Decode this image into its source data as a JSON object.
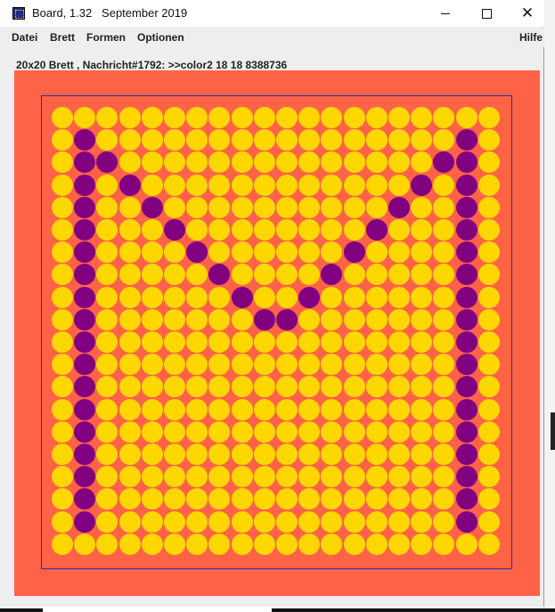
{
  "window": {
    "title": "Board, 1.32   September 2019",
    "minimize_icon": "minimize-icon",
    "maximize_icon": "maximize-icon",
    "close_icon": "close-icon",
    "close_glyph": "✕"
  },
  "menu": {
    "items": [
      "Datei",
      "Brett",
      "Formen",
      "Optionen"
    ],
    "help": "Hilfe"
  },
  "status": {
    "text": "20x20 Brett , Nachricht#1792: >>color2 18 18 8388736"
  },
  "board": {
    "rows": 20,
    "cols": 20,
    "background_color": "#ff6347",
    "border_color": "#2a2ab0",
    "default_color": "#ffd700",
    "marked_color": "#800080",
    "marked_cells": [
      [
        1,
        1
      ],
      [
        2,
        1
      ],
      [
        3,
        1
      ],
      [
        4,
        1
      ],
      [
        5,
        1
      ],
      [
        6,
        1
      ],
      [
        7,
        1
      ],
      [
        8,
        1
      ],
      [
        9,
        1
      ],
      [
        10,
        1
      ],
      [
        11,
        1
      ],
      [
        12,
        1
      ],
      [
        13,
        1
      ],
      [
        14,
        1
      ],
      [
        15,
        1
      ],
      [
        16,
        1
      ],
      [
        17,
        1
      ],
      [
        18,
        1
      ],
      [
        1,
        18
      ],
      [
        2,
        18
      ],
      [
        3,
        18
      ],
      [
        4,
        18
      ],
      [
        5,
        18
      ],
      [
        6,
        18
      ],
      [
        7,
        18
      ],
      [
        8,
        18
      ],
      [
        9,
        18
      ],
      [
        10,
        18
      ],
      [
        11,
        18
      ],
      [
        12,
        18
      ],
      [
        13,
        18
      ],
      [
        14,
        18
      ],
      [
        15,
        18
      ],
      [
        16,
        18
      ],
      [
        17,
        18
      ],
      [
        18,
        18
      ],
      [
        2,
        2
      ],
      [
        3,
        3
      ],
      [
        4,
        4
      ],
      [
        5,
        5
      ],
      [
        6,
        6
      ],
      [
        7,
        7
      ],
      [
        8,
        8
      ],
      [
        9,
        9
      ],
      [
        2,
        17
      ],
      [
        3,
        16
      ],
      [
        4,
        15
      ],
      [
        5,
        14
      ],
      [
        6,
        13
      ],
      [
        7,
        12
      ],
      [
        8,
        11
      ],
      [
        9,
        10
      ]
    ]
  }
}
